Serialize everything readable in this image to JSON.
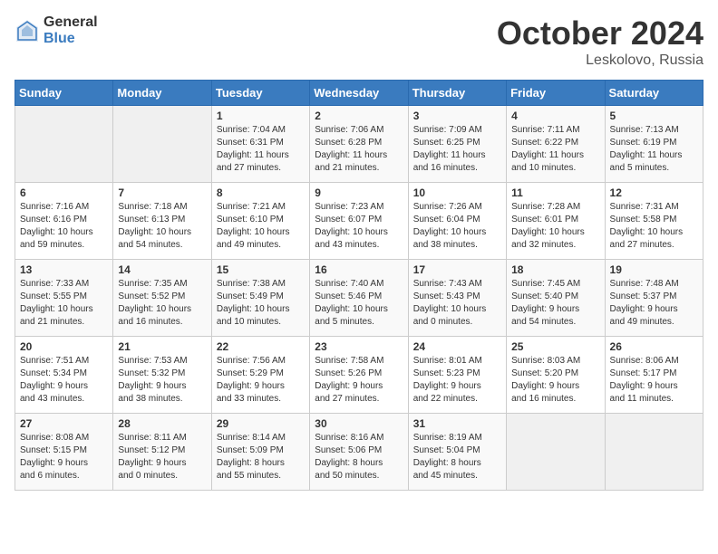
{
  "header": {
    "logo_general": "General",
    "logo_blue": "Blue",
    "month_title": "October 2024",
    "location": "Leskolovo, Russia"
  },
  "weekdays": [
    "Sunday",
    "Monday",
    "Tuesday",
    "Wednesday",
    "Thursday",
    "Friday",
    "Saturday"
  ],
  "weeks": [
    [
      {
        "day": "",
        "info": ""
      },
      {
        "day": "",
        "info": ""
      },
      {
        "day": "1",
        "info": "Sunrise: 7:04 AM\nSunset: 6:31 PM\nDaylight: 11 hours\nand 27 minutes."
      },
      {
        "day": "2",
        "info": "Sunrise: 7:06 AM\nSunset: 6:28 PM\nDaylight: 11 hours\nand 21 minutes."
      },
      {
        "day": "3",
        "info": "Sunrise: 7:09 AM\nSunset: 6:25 PM\nDaylight: 11 hours\nand 16 minutes."
      },
      {
        "day": "4",
        "info": "Sunrise: 7:11 AM\nSunset: 6:22 PM\nDaylight: 11 hours\nand 10 minutes."
      },
      {
        "day": "5",
        "info": "Sunrise: 7:13 AM\nSunset: 6:19 PM\nDaylight: 11 hours\nand 5 minutes."
      }
    ],
    [
      {
        "day": "6",
        "info": "Sunrise: 7:16 AM\nSunset: 6:16 PM\nDaylight: 10 hours\nand 59 minutes."
      },
      {
        "day": "7",
        "info": "Sunrise: 7:18 AM\nSunset: 6:13 PM\nDaylight: 10 hours\nand 54 minutes."
      },
      {
        "day": "8",
        "info": "Sunrise: 7:21 AM\nSunset: 6:10 PM\nDaylight: 10 hours\nand 49 minutes."
      },
      {
        "day": "9",
        "info": "Sunrise: 7:23 AM\nSunset: 6:07 PM\nDaylight: 10 hours\nand 43 minutes."
      },
      {
        "day": "10",
        "info": "Sunrise: 7:26 AM\nSunset: 6:04 PM\nDaylight: 10 hours\nand 38 minutes."
      },
      {
        "day": "11",
        "info": "Sunrise: 7:28 AM\nSunset: 6:01 PM\nDaylight: 10 hours\nand 32 minutes."
      },
      {
        "day": "12",
        "info": "Sunrise: 7:31 AM\nSunset: 5:58 PM\nDaylight: 10 hours\nand 27 minutes."
      }
    ],
    [
      {
        "day": "13",
        "info": "Sunrise: 7:33 AM\nSunset: 5:55 PM\nDaylight: 10 hours\nand 21 minutes."
      },
      {
        "day": "14",
        "info": "Sunrise: 7:35 AM\nSunset: 5:52 PM\nDaylight: 10 hours\nand 16 minutes."
      },
      {
        "day": "15",
        "info": "Sunrise: 7:38 AM\nSunset: 5:49 PM\nDaylight: 10 hours\nand 10 minutes."
      },
      {
        "day": "16",
        "info": "Sunrise: 7:40 AM\nSunset: 5:46 PM\nDaylight: 10 hours\nand 5 minutes."
      },
      {
        "day": "17",
        "info": "Sunrise: 7:43 AM\nSunset: 5:43 PM\nDaylight: 10 hours\nand 0 minutes."
      },
      {
        "day": "18",
        "info": "Sunrise: 7:45 AM\nSunset: 5:40 PM\nDaylight: 9 hours\nand 54 minutes."
      },
      {
        "day": "19",
        "info": "Sunrise: 7:48 AM\nSunset: 5:37 PM\nDaylight: 9 hours\nand 49 minutes."
      }
    ],
    [
      {
        "day": "20",
        "info": "Sunrise: 7:51 AM\nSunset: 5:34 PM\nDaylight: 9 hours\nand 43 minutes."
      },
      {
        "day": "21",
        "info": "Sunrise: 7:53 AM\nSunset: 5:32 PM\nDaylight: 9 hours\nand 38 minutes."
      },
      {
        "day": "22",
        "info": "Sunrise: 7:56 AM\nSunset: 5:29 PM\nDaylight: 9 hours\nand 33 minutes."
      },
      {
        "day": "23",
        "info": "Sunrise: 7:58 AM\nSunset: 5:26 PM\nDaylight: 9 hours\nand 27 minutes."
      },
      {
        "day": "24",
        "info": "Sunrise: 8:01 AM\nSunset: 5:23 PM\nDaylight: 9 hours\nand 22 minutes."
      },
      {
        "day": "25",
        "info": "Sunrise: 8:03 AM\nSunset: 5:20 PM\nDaylight: 9 hours\nand 16 minutes."
      },
      {
        "day": "26",
        "info": "Sunrise: 8:06 AM\nSunset: 5:17 PM\nDaylight: 9 hours\nand 11 minutes."
      }
    ],
    [
      {
        "day": "27",
        "info": "Sunrise: 8:08 AM\nSunset: 5:15 PM\nDaylight: 9 hours\nand 6 minutes."
      },
      {
        "day": "28",
        "info": "Sunrise: 8:11 AM\nSunset: 5:12 PM\nDaylight: 9 hours\nand 0 minutes."
      },
      {
        "day": "29",
        "info": "Sunrise: 8:14 AM\nSunset: 5:09 PM\nDaylight: 8 hours\nand 55 minutes."
      },
      {
        "day": "30",
        "info": "Sunrise: 8:16 AM\nSunset: 5:06 PM\nDaylight: 8 hours\nand 50 minutes."
      },
      {
        "day": "31",
        "info": "Sunrise: 8:19 AM\nSunset: 5:04 PM\nDaylight: 8 hours\nand 45 minutes."
      },
      {
        "day": "",
        "info": ""
      },
      {
        "day": "",
        "info": ""
      }
    ]
  ]
}
